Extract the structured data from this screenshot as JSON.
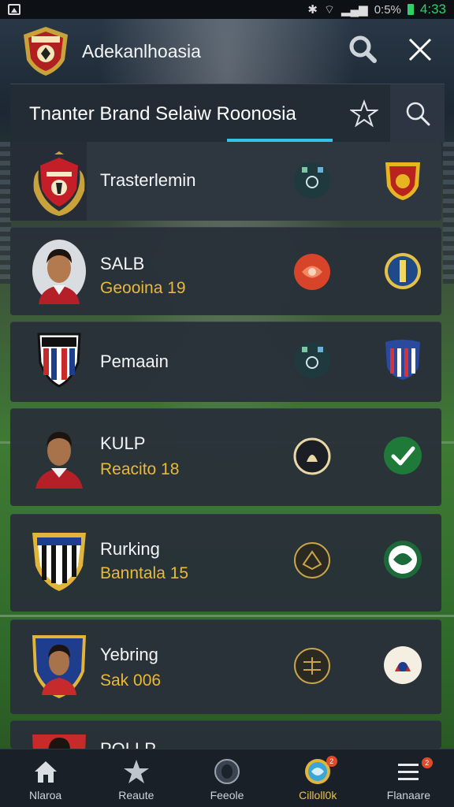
{
  "status_bar": {
    "signal_text": "0:5%",
    "time": "4:33"
  },
  "header": {
    "title": "Adekanlhoasia"
  },
  "panel": {
    "title": "Tnanter Brand Selaiw Roonosia"
  },
  "list": [
    {
      "name": "Trasterlemin",
      "sub": ""
    },
    {
      "name": "SALB",
      "sub": "Geooina 19"
    },
    {
      "name": "Pemaain",
      "sub": ""
    },
    {
      "name": "KULP",
      "sub": "Reacito 18"
    },
    {
      "name": "Rurking",
      "sub": "Banntala 15"
    },
    {
      "name": "Yebring",
      "sub": "Sak 006"
    },
    {
      "name": "POLLP",
      "sub": ""
    }
  ],
  "bottom_nav": [
    {
      "label": "Nlaroa",
      "icon": "home-icon"
    },
    {
      "label": "Reaute",
      "icon": "star-icon"
    },
    {
      "label": "Feeole",
      "icon": "circle-icon"
    },
    {
      "label": "Cilloll0k",
      "icon": "globe-icon",
      "badge": "2"
    },
    {
      "label": "Flanaare",
      "icon": "menu-icon",
      "badge": "2"
    }
  ],
  "colors": {
    "accent": "#35c2e6",
    "gold": "#e9b938",
    "panel": "#232b35",
    "check_green": "#1f7a3a"
  }
}
